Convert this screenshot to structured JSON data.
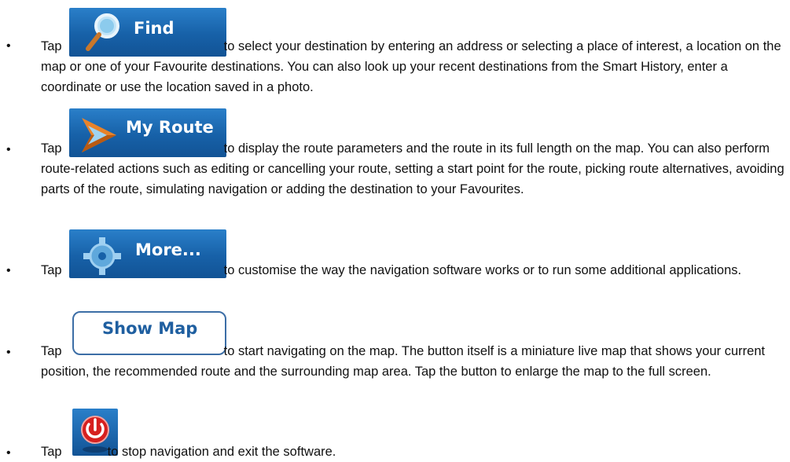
{
  "bullet_symbol": "•",
  "items": [
    {
      "tap": "Tap",
      "button_label": "Find",
      "icon": "magnifier-icon",
      "text": "to select your destination by entering an address or selecting a place of interest, a location on the map or one of your Favourite destinations. You can also look up your recent destinations from the Smart History, enter a coordinate or use the location saved in a photo."
    },
    {
      "tap": "Tap",
      "button_label": "My Route",
      "icon": "route-arrow-icon",
      "text": "to display the route parameters and the route in its full length on the map. You can also perform route-related actions such as editing or cancelling your route, setting a start point for the route, picking route alternatives, avoiding parts of the route, simulating navigation or adding the destination to your Favourites."
    },
    {
      "tap": "Tap",
      "button_label": "More...",
      "icon": "gear-tools-icon",
      "text": "to customise the way the navigation software works or  to run some additional applications."
    },
    {
      "tap": "Tap",
      "button_label": "Show Map",
      "icon": "",
      "text": "to start navigating on the map. The button itself is a miniature live map that shows your current position, the recommended route and the surrounding map area. Tap the button to enlarge the map to the full screen."
    },
    {
      "tap": "Tap",
      "button_label": "",
      "icon": "power-icon",
      "text": "to stop navigation and exit the software."
    }
  ],
  "colors": {
    "button_blue": "#1761a8",
    "power_red": "#d6201f",
    "show_map_border": "#3c6ea6"
  }
}
